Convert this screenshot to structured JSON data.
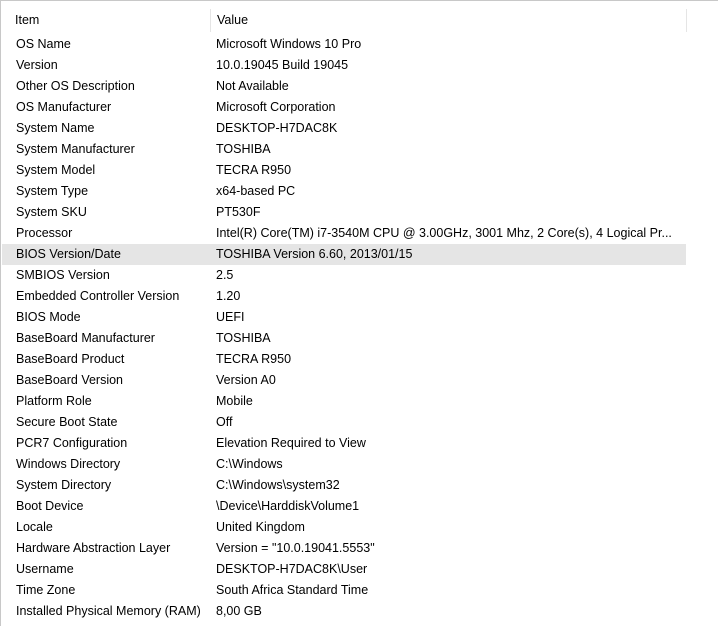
{
  "header": {
    "item": "Item",
    "value": "Value"
  },
  "rows": [
    {
      "item": "OS Name",
      "value": "Microsoft Windows 10 Pro"
    },
    {
      "item": "Version",
      "value": "10.0.19045 Build 19045"
    },
    {
      "item": "Other OS Description",
      "value": "Not Available"
    },
    {
      "item": "OS Manufacturer",
      "value": "Microsoft Corporation"
    },
    {
      "item": "System Name",
      "value": "DESKTOP-H7DAC8K"
    },
    {
      "item": "System Manufacturer",
      "value": "TOSHIBA"
    },
    {
      "item": "System Model",
      "value": "TECRA R950"
    },
    {
      "item": "System Type",
      "value": "x64-based PC"
    },
    {
      "item": "System SKU",
      "value": "PT530F"
    },
    {
      "item": "Processor",
      "value": "Intel(R) Core(TM) i7-3540M CPU @ 3.00GHz, 3001 Mhz, 2 Core(s), 4 Logical Pr..."
    },
    {
      "item": "BIOS Version/Date",
      "value": "TOSHIBA Version 6.60, 2013/01/15",
      "selected": true
    },
    {
      "item": "SMBIOS Version",
      "value": "2.5"
    },
    {
      "item": "Embedded Controller Version",
      "value": "1.20"
    },
    {
      "item": "BIOS Mode",
      "value": "UEFI"
    },
    {
      "item": "BaseBoard Manufacturer",
      "value": "TOSHIBA"
    },
    {
      "item": "BaseBoard Product",
      "value": "TECRA R950"
    },
    {
      "item": "BaseBoard Version",
      "value": "Version A0"
    },
    {
      "item": "Platform Role",
      "value": "Mobile"
    },
    {
      "item": "Secure Boot State",
      "value": "Off"
    },
    {
      "item": "PCR7 Configuration",
      "value": "Elevation Required to View"
    },
    {
      "item": "Windows Directory",
      "value": "C:\\Windows"
    },
    {
      "item": "System Directory",
      "value": "C:\\Windows\\system32"
    },
    {
      "item": "Boot Device",
      "value": "\\Device\\HarddiskVolume1"
    },
    {
      "item": "Locale",
      "value": "United Kingdom"
    },
    {
      "item": "Hardware Abstraction Layer",
      "value": "Version = \"10.0.19041.5553\""
    },
    {
      "item": "Username",
      "value": "DESKTOP-H7DAC8K\\User"
    },
    {
      "item": "Time Zone",
      "value": "South Africa Standard Time"
    },
    {
      "item": "Installed Physical Memory (RAM)",
      "value": "8,00 GB"
    }
  ]
}
